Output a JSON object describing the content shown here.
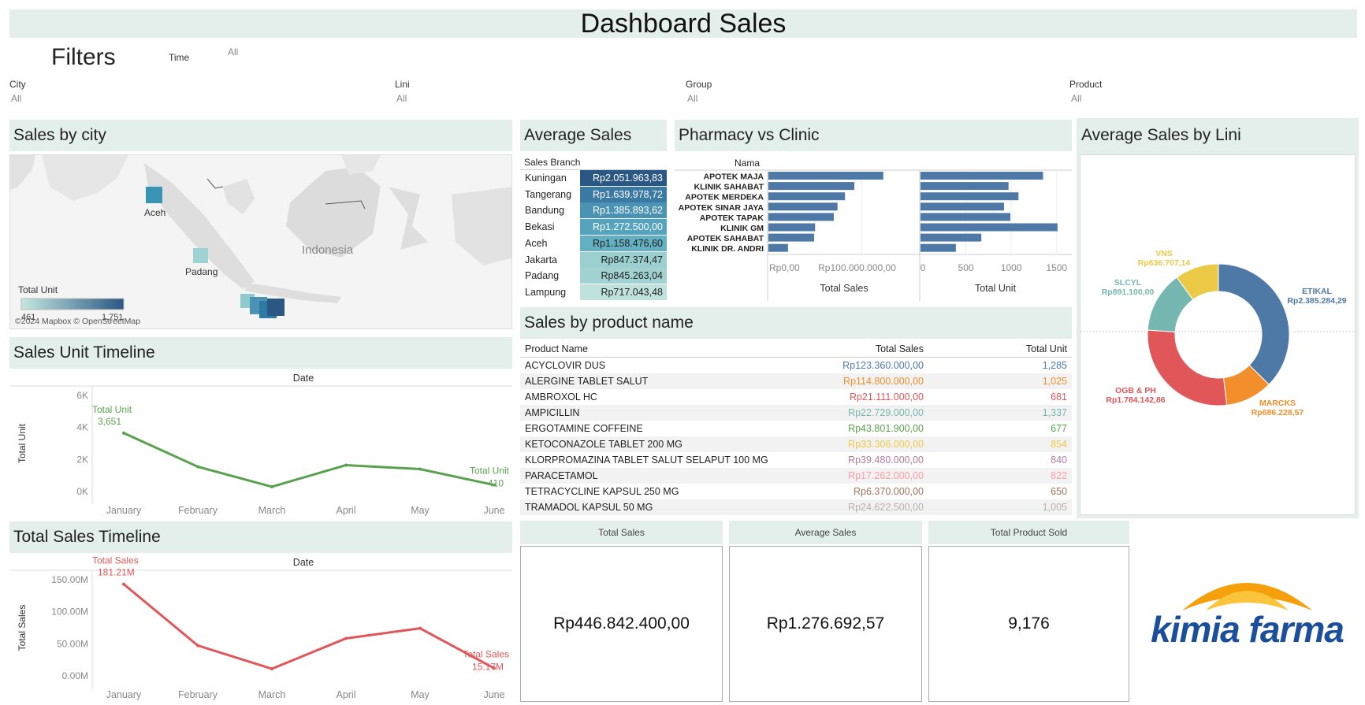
{
  "title": "Dashboard Sales",
  "filters": {
    "heading": "Filters",
    "time": {
      "label": "Time",
      "value": "All"
    },
    "city": {
      "label": "City",
      "value": "All"
    },
    "lini": {
      "label": "Lini",
      "value": "All"
    },
    "group": {
      "label": "Group",
      "value": "All"
    },
    "product": {
      "label": "Product",
      "value": "All"
    }
  },
  "sales_by_city": {
    "title": "Sales by city",
    "labels": {
      "aceh": "Aceh",
      "padang": "Padang",
      "indonesia": "Indonesia"
    },
    "legend_title": "Total Unit",
    "legend_min": "461",
    "legend_max": "1,751",
    "attribution": "©2024 Mapbox © OpenStreetMap"
  },
  "average_sales": {
    "title": "Average Sales",
    "column_header": "Sales Branch",
    "rows": [
      {
        "name": "Kuningan",
        "value": "Rp2.051.963,83",
        "bg": "#2a5783",
        "fg": "#ffffff"
      },
      {
        "name": "Tangerang",
        "value": "Rp1.639.978,72",
        "bg": "#3b7aa3",
        "fg": "#ffffff"
      },
      {
        "name": "Bandung",
        "value": "Rp1.385.893,62",
        "bg": "#4a93b5",
        "fg": "#ffffff"
      },
      {
        "name": "Bekasi",
        "value": "Rp1.272.500,00",
        "bg": "#55a3bd",
        "fg": "#ffffff"
      },
      {
        "name": "Aceh",
        "value": "Rp1.158.476,60",
        "bg": "#62b0c1",
        "fg": "#222222"
      },
      {
        "name": "Jakarta",
        "value": "Rp847.374,47",
        "bg": "#9ccfd0",
        "fg": "#222222"
      },
      {
        "name": "Padang",
        "value": "Rp845.263,04",
        "bg": "#a2d2d2",
        "fg": "#222222"
      },
      {
        "name": "Lampung",
        "value": "Rp717.043,48",
        "bg": "#bfe3dc",
        "fg": "#222222"
      }
    ]
  },
  "pharmacy_vs_clinic": {
    "title": "Pharmacy vs Clinic",
    "column_header": "Nama",
    "sales_axis_title": "Total Sales",
    "unit_axis_title": "Total Unit",
    "sales_ticks": [
      {
        "label": "Rp0,00",
        "v": 0
      },
      {
        "label": "Rp100.000.000,00",
        "v": 100000000
      }
    ],
    "unit_ticks": [
      {
        "label": "0",
        "v": 0
      },
      {
        "label": "500",
        "v": 500
      },
      {
        "label": "1000",
        "v": 1000
      },
      {
        "label": "1500",
        "v": 1500
      }
    ],
    "bar_color": "#4e79a7"
  },
  "chart_data": [
    {
      "type": "bar",
      "orientation": "horizontal",
      "categories": [
        "APOTEK MAJA",
        "KLINIK SAHABAT",
        "APOTEK MERDEKA",
        "APOTEK SINAR JAYA",
        "APOTEK TAPAK",
        "KLINIK GM",
        "APOTEK SAHABAT",
        "KLINIK DR. ANDRI"
      ],
      "series": [
        {
          "name": "Total Sales",
          "values": [
            123000000,
            92000000,
            82000000,
            74000000,
            70000000,
            50000000,
            49000000,
            21000000
          ]
        },
        {
          "name": "Total Unit",
          "values": [
            1350,
            970,
            1080,
            920,
            990,
            1510,
            670,
            390
          ]
        }
      ],
      "xlim_sales": [
        0,
        135000000
      ],
      "xlim_unit": [
        0,
        1650
      ]
    },
    {
      "type": "line",
      "title": "Date",
      "ylabel": "Total Unit",
      "categories": [
        "January",
        "February",
        "March",
        "April",
        "May",
        "June"
      ],
      "series": [
        {
          "name": "Total Unit",
          "values": [
            3651,
            1550,
            300,
            1650,
            1400,
            410
          ]
        }
      ],
      "yticks": [
        "6K",
        "4K",
        "2K",
        "0K"
      ],
      "ylim": [
        0,
        6000
      ],
      "labels": {
        "first": "Total Unit",
        "first_value": "3,651",
        "last": "Total Unit",
        "last_value": "410"
      },
      "color": "#59a14f"
    },
    {
      "type": "line",
      "title": "Date",
      "ylabel": "Total Sales",
      "categories": [
        "January",
        "February",
        "March",
        "April",
        "May",
        "June"
      ],
      "series": [
        {
          "name": "Total Sales",
          "values": [
            181210000,
            60000000,
            14000000,
            74000000,
            94000000,
            15170000
          ]
        }
      ],
      "yticks": [
        "150.00M",
        "100.00M",
        "50.00M",
        "0.00M"
      ],
      "ylim": [
        0,
        190000000
      ],
      "labels": {
        "first": "Total Sales",
        "first_value": "181.21M",
        "last": "Total Sales",
        "last_value": "15.17M"
      },
      "color": "#e15759"
    },
    {
      "type": "pie",
      "title": "Average Sales by Lini",
      "categories": [
        "ETIKAL",
        "MARCKS",
        "OGB & PH",
        "SLCYL",
        "VNS"
      ],
      "values": [
        2385284.29,
        686228.57,
        1784142.86,
        891100.0,
        636707.14
      ],
      "value_labels": [
        "Rp2.385.284,29",
        "Rp686.228,57",
        "Rp1.784.142,86",
        "Rp891.100,00",
        "Rp636.707,14"
      ],
      "colors": [
        "#4e79a7",
        "#f28e2b",
        "#e15759",
        "#76b7b2",
        "#edc948"
      ]
    }
  ],
  "sales_unit_timeline": {
    "title": "Sales Unit Timeline"
  },
  "total_sales_timeline": {
    "title": "Total Sales Timeline"
  },
  "average_sales_by_lini": {
    "title": "Average Sales by Lini"
  },
  "sales_by_product": {
    "title": "Sales by product name",
    "headers": {
      "name": "Product Name",
      "sales": "Total Sales",
      "unit": "Total Unit"
    },
    "rows": [
      {
        "name": "ACYCLOVIR DUS",
        "sales": "Rp123.360.000,00",
        "unit": "1,285",
        "color": "#4e79a7"
      },
      {
        "name": "ALERGINE TABLET SALUT",
        "sales": "Rp114.800.000,00",
        "unit": "1,025",
        "color": "#f28e2b"
      },
      {
        "name": "AMBROXOL HC",
        "sales": "Rp21.111.000,00",
        "unit": "681",
        "color": "#e15759"
      },
      {
        "name": "AMPICILLIN",
        "sales": "Rp22.729.000,00",
        "unit": "1,337",
        "color": "#76b7b2"
      },
      {
        "name": "ERGOTAMINE COFFEINE",
        "sales": "Rp43.801.900,00",
        "unit": "677",
        "color": "#59a14f"
      },
      {
        "name": "KETOCONAZOLE TABLET 200 MG",
        "sales": "Rp33.306.000,00",
        "unit": "854",
        "color": "#edc948"
      },
      {
        "name": "KLORPROMAZINA TABLET SALUT SELAPUT 100 MG",
        "sales": "Rp39.480.000,00",
        "unit": "840",
        "color": "#b07aa1"
      },
      {
        "name": "PARACETAMOL",
        "sales": "Rp17.262.000,00",
        "unit": "822",
        "color": "#ff9da7"
      },
      {
        "name": "TETRACYCLINE KAPSUL 250 MG",
        "sales": "Rp6.370.000,00",
        "unit": "650",
        "color": "#9c755f"
      },
      {
        "name": "TRAMADOL KAPSUL 50 MG",
        "sales": "Rp24.622.500,00",
        "unit": "1,005",
        "color": "#bab0ac"
      }
    ]
  },
  "kpis": [
    {
      "label": "Total Sales",
      "value": "Rp446.842.400,00"
    },
    {
      "label": "Average Sales",
      "value": "Rp1.276.692,57"
    },
    {
      "label": "Total Product Sold",
      "value": "9,176"
    }
  ],
  "logo": {
    "text": "kimia farma",
    "brand_color": "#1b4f9c",
    "sun_color": "#f5a00a"
  }
}
